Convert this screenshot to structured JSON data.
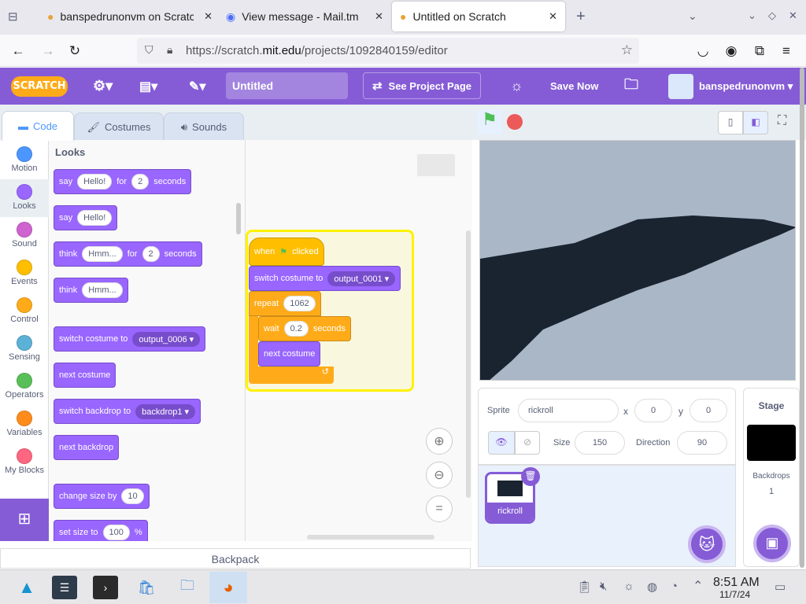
{
  "browser": {
    "tabs": [
      {
        "title": "banspedrunonvm on Scratch",
        "icon": "scratch-tab-icon"
      },
      {
        "title": "View message - Mail.tm",
        "icon": "mail-tab-icon"
      },
      {
        "title": "Untitled on Scratch",
        "icon": "scratch-tab-icon"
      }
    ],
    "url_prefix": "https://scratch.",
    "url_domain": "mit.edu",
    "url_path": "/projects/1092840159/editor"
  },
  "scratch": {
    "logo": "SCRATCH",
    "project_title": "Untitled",
    "see_project_page": "See Project Page",
    "save_now": "Save Now",
    "username": "banspedrunonvm",
    "accent": "#855cd6"
  },
  "editor_tabs": [
    "Code",
    "Costumes",
    "Sounds"
  ],
  "categories": [
    {
      "label": "Motion",
      "color": "#4c97ff"
    },
    {
      "label": "Looks",
      "color": "#9966ff"
    },
    {
      "label": "Sound",
      "color": "#cf63cf"
    },
    {
      "label": "Events",
      "color": "#ffbf00"
    },
    {
      "label": "Control",
      "color": "#ffab19"
    },
    {
      "label": "Sensing",
      "color": "#5cb1d6"
    },
    {
      "label": "Operators",
      "color": "#59c059"
    },
    {
      "label": "Variables",
      "color": "#ff8c1a"
    },
    {
      "label": "My Blocks",
      "color": "#ff6680"
    }
  ],
  "palette": {
    "heading": "Looks",
    "say_for": {
      "say": "say",
      "msg": "Hello!",
      "for": "for",
      "secs": "2",
      "seconds": "seconds"
    },
    "say": {
      "say": "say",
      "msg": "Hello!"
    },
    "think_for": {
      "think": "think",
      "msg": "Hmm...",
      "for": "for",
      "secs": "2",
      "seconds": "seconds"
    },
    "think": {
      "think": "think",
      "msg": "Hmm..."
    },
    "switch_costume": {
      "label": "switch costume to",
      "value": "output_0006"
    },
    "next_costume": "next costume",
    "switch_backdrop": {
      "label": "switch backdrop to",
      "value": "backdrop1"
    },
    "next_backdrop": "next backdrop",
    "change_size": {
      "label": "change size by",
      "value": "10"
    },
    "set_size": {
      "label": "set size to",
      "value": "100",
      "unit": "%"
    }
  },
  "script": {
    "when": "when",
    "clicked": "clicked",
    "switch_label": "switch costume to",
    "switch_value": "output_0001",
    "repeat": "repeat",
    "repeat_count": "1062",
    "wait": "wait",
    "wait_value": "0.2",
    "seconds": "seconds",
    "next_costume": "next costume"
  },
  "sprite": {
    "sprite_label": "Sprite",
    "name": "rickroll",
    "x_label": "x",
    "x": "0",
    "y_label": "y",
    "y": "0",
    "size_label": "Size",
    "size": "150",
    "direction_label": "Direction",
    "direction": "90",
    "thumb_name": "rickroll"
  },
  "stage_panel": {
    "title": "Stage",
    "backdrops_label": "Backdrops",
    "backdrops_count": "1"
  },
  "backpack": "Backpack",
  "taskbar": {
    "time": "8:51 AM",
    "date": "11/7/24"
  }
}
